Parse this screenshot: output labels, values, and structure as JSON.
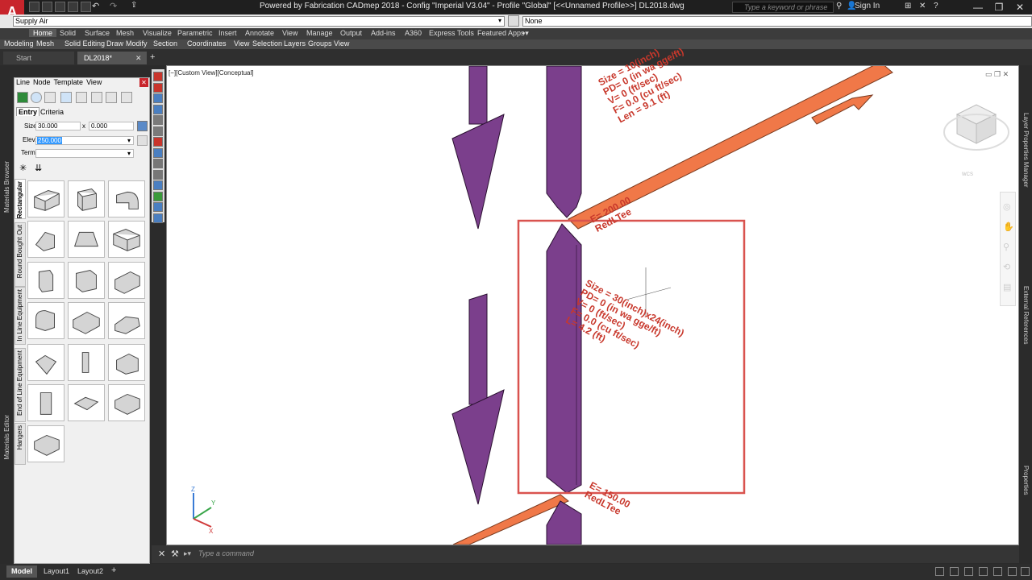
{
  "window": {
    "title": "Powered by Fabrication CADmep 2018 - Config \"Imperial V3.04\" - Profile \"Global\"  [<<Unnamed Profile>>]    DL2018.dwg",
    "search_placeholder": "Type a keyword or phrase",
    "sign_in": "Sign In"
  },
  "properties": {
    "layer_value": "Supply Air",
    "color_value": "None"
  },
  "ribbon": {
    "tabs": [
      "Home",
      "Solid",
      "Surface",
      "Mesh",
      "Visualize",
      "Parametric",
      "Insert",
      "Annotate",
      "View",
      "Manage",
      "Output",
      "Add-ins",
      "A360",
      "Express Tools",
      "Featured Apps"
    ],
    "panels": [
      "Modeling",
      "Mesh",
      "Solid Editing",
      "Draw",
      "Modify",
      "Section",
      "Coordinates",
      "View",
      "Selection",
      "Layers",
      "Groups",
      "View"
    ]
  },
  "file_tabs": {
    "start": "Start",
    "document": "DL2018*"
  },
  "side_labels": {
    "materials_browser": "Materials Browser",
    "materials_editor": "Materials Editor",
    "layer_properties": "Layer Properties Manager",
    "external_references": "External References",
    "properties": "Properties"
  },
  "palette": {
    "menu": [
      "Line",
      "Node",
      "Template",
      "View"
    ],
    "tab_entry": "Entry",
    "tab_criteria": "Criteria",
    "size_label": "Size",
    "size_w": "30.000",
    "size_x": "x",
    "size_h": "0.000",
    "elev_label": "Elev.",
    "elev_value": "250.000",
    "term_label": "Term.",
    "categories": [
      "Rectangular",
      "Round Bought Out",
      "In Line Equipment",
      "End of Line Equipment",
      "Hangers"
    ]
  },
  "viewport": {
    "label": "[−][Custom View][Conceptual]",
    "annotation_top": [
      "Size = 10(inch)",
      "PD= 0 (in wa gge/ft)",
      "V= 0 (ft/sec)",
      "F= 0.0 (cu ft/sec)",
      "Len = 9.1 (ft)"
    ],
    "annotation_elev_top": [
      "E= 200.00",
      "RedLTee"
    ],
    "annotation_mid": [
      "Size = 30(inch)x24(inch)",
      "PD= 0 (in wa gge/ft)",
      "V= 0 (ft/sec)",
      "F= 0.0 (cu ft/sec)",
      "L= 4.2 (ft)"
    ],
    "annotation_elev_bottom": [
      "E= 150.00",
      "RedLTee"
    ],
    "viewcube_label": "WCS",
    "duct_color": "#7b3f8c",
    "round_duct_color": "#f07848",
    "annotation_color": "#c8382c",
    "selection_color": "#d9534f"
  },
  "command": {
    "placeholder": "Type a command"
  },
  "status": {
    "tabs": [
      "Model",
      "Layout1",
      "Layout2"
    ]
  }
}
